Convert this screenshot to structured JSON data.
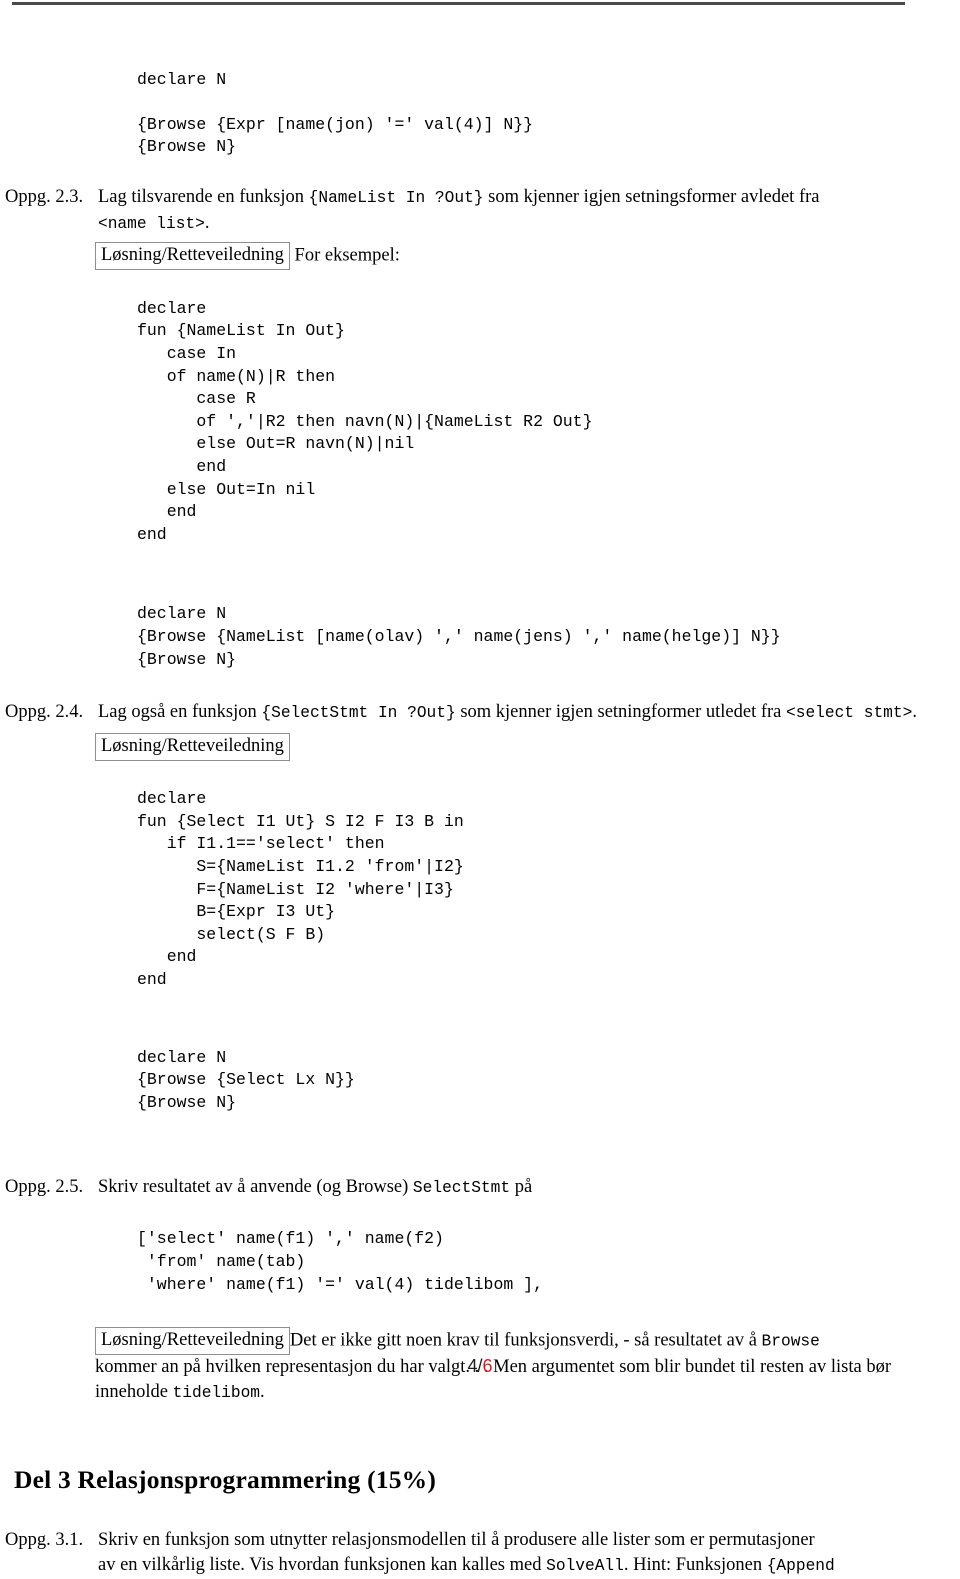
{
  "document": {
    "footer": {
      "current_page": "4",
      "separator": "/",
      "total_pages": "6",
      "total_color": "#cc2229"
    }
  },
  "top_code_block": {
    "lines": "declare N\n\n{Browse {Expr [name(jon) '=' val(4)] N}}\n{Browse N}"
  },
  "exercises": [
    {
      "label": "Oppg. 2.3.",
      "text_part1": "Lag tilsvarende en funksjon ",
      "code1": "{NameList In ?Out}",
      "text_part2": " som kjenner igjen setningsformer avledet fra",
      "code2": "<name list>",
      "text_part3": "."
    },
    {
      "label": "Oppg. 2.4.",
      "text_part1": "Lag også en funksjon ",
      "code1": "{SelectStmt In ?Out}",
      "text_part2": " som kjenner igjen setningformer utledet fra ",
      "code2": "<select stmt>",
      "text_part3": "."
    },
    {
      "label": "Oppg. 2.5.",
      "text_part1": "Skriv resultatet av å anvende (og Browse) ",
      "code1": "SelectStmt",
      "text_part2": " på"
    },
    {
      "label": "Oppg. 3.1.",
      "line1_a": "Skriv en funksjon som utnytter relasjonsmodellen til å produsere alle lister som er permutasjoner",
      "line2_a": "av en vilkårlig liste. Vis hvordan funksjonen kan kalles med ",
      "line2_code1": "SolveAll",
      "line2_b": ". Hint: Funksjonen ",
      "line2_code2": "{Append"
    }
  ],
  "solution_boxes": {
    "box_label": "Løsning/Retteveiledning",
    "box_label_23": "Løsning/Retteveiledning",
    "box_label_24": "Løsning/Retteveiledning",
    "box_label_25": "Løsning/Retteveiledning",
    "trailing_23": "For eksempel:",
    "border_color": "#8e8e8e"
  },
  "code_blocks": {
    "namelist_definition": "declare\nfun {NameList In Out}\n   case In\n   of name(N)|R then\n      case R\n      of ','|R2 then navn(N)|{NameList R2 Out}\n      else Out=R navn(N)|nil\n      end\n   else Out=In nil\n   end\nend",
    "namelist_usage": "declare N\n{Browse {NameList [name(olav) ',' name(jens) ',' name(helge)] N}}\n{Browse N}",
    "select_definition": "declare\nfun {Select I1 Ut} S I2 F I3 B in\n   if I1.1=='select' then\n      S={NameList I1.2 'from'|I2}\n      F={NameList I2 'where'|I3}\n      B={Expr I3 Ut}\n      select(S F B)\n   end\nend",
    "select_usage": "declare N\n{Browse {Select Lx N}}\n{Browse N}",
    "select_query_literal": "['select' name(f1) ',' name(f2)\n 'from' name(tab)\n 'where' name(f1) '=' val(4) tidelibom ],"
  },
  "answer_25": {
    "sentence_a": "Det er ikke gitt noen krav til funksjonsverdi, - så resultatet av å ",
    "code_browse": "Browse",
    "sentence_b": "kommer an på hvilken representasjon du har valgt. . . Men argumentet som blir bundet til resten av lista bør inneholde ",
    "code_tidelibom": "tidelibom",
    "sentence_c": "."
  },
  "part3": {
    "heading": "Del 3 Relasjonsprogrammering (15%)"
  }
}
